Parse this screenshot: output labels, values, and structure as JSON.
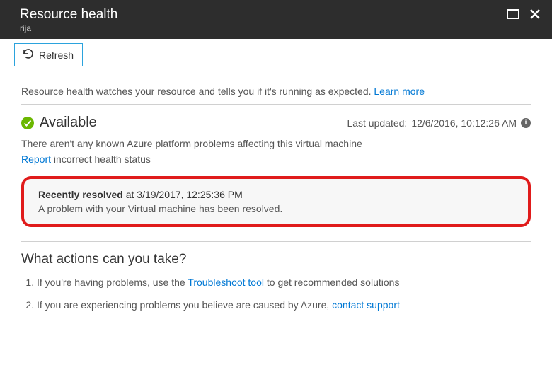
{
  "header": {
    "title": "Resource health",
    "subtitle": "rija"
  },
  "toolbar": {
    "refresh_label": "Refresh"
  },
  "intro": {
    "text": "Resource health watches your resource and tells you if it's running as expected.",
    "link": "Learn more"
  },
  "status": {
    "label": "Available",
    "last_updated_prefix": "Last updated:",
    "last_updated_value": "12/6/2016, 10:12:26 AM",
    "description": "There aren't any known Azure platform problems affecting this virtual machine",
    "report_link": "Report",
    "report_rest": " incorrect health status"
  },
  "resolved": {
    "title": "Recently resolved",
    "at_text": " at 3/19/2017, 12:25:36 PM",
    "description": "A problem with your Virtual machine has been resolved."
  },
  "actions": {
    "heading": "What actions can you take?",
    "items": [
      {
        "pre": "If you're having problems, use the ",
        "link": "Troubleshoot tool",
        "post": " to get recommended solutions"
      },
      {
        "pre": "If you are experiencing problems you believe are caused by Azure, ",
        "link": "contact support",
        "post": ""
      }
    ]
  }
}
